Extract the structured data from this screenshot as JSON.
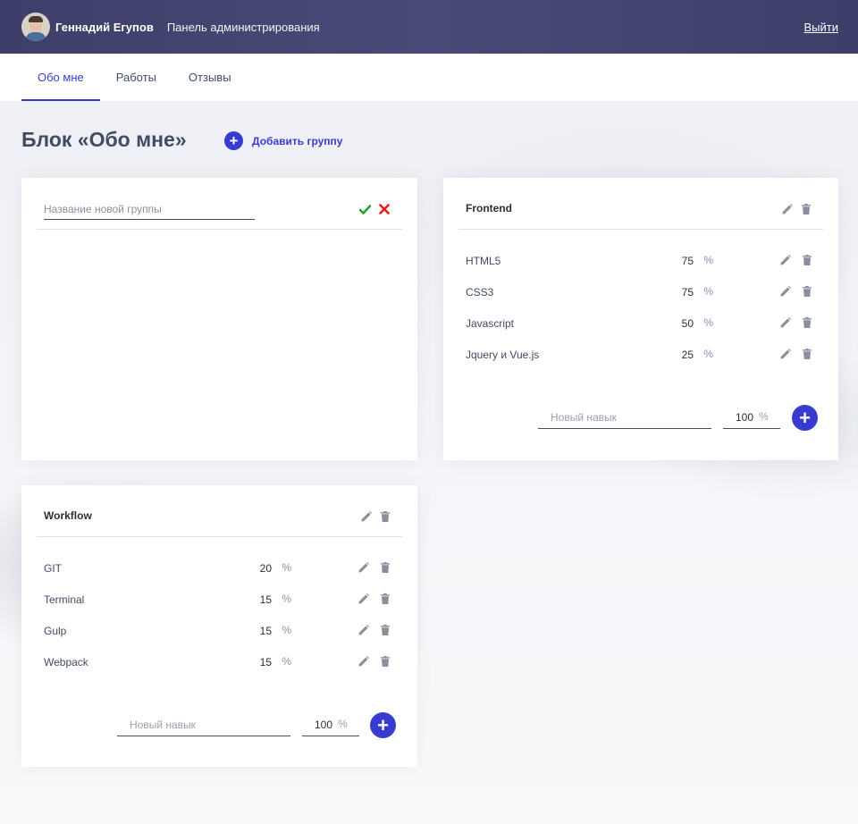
{
  "header": {
    "user_name": "Геннадий Егупов",
    "panel_title": "Панель администрирования",
    "logout_label": "Выйти"
  },
  "tabs": [
    {
      "label": "Обо мне",
      "active": true
    },
    {
      "label": "Работы",
      "active": false
    },
    {
      "label": "Отзывы",
      "active": false
    }
  ],
  "main": {
    "title": "Блок «Обо мне»",
    "add_group_label": "Добавить группу",
    "add_group_icon": "+"
  },
  "new_group_card": {
    "placeholder": "Название новой группы",
    "confirm_icon": "check-icon",
    "cancel_icon": "close-icon"
  },
  "groups": [
    {
      "name": "Frontend",
      "skills": [
        {
          "name": "HTML5",
          "percent": "75",
          "unit": "%"
        },
        {
          "name": "CSS3",
          "percent": "75",
          "unit": "%"
        },
        {
          "name": "Javascript",
          "percent": "50",
          "unit": "%"
        },
        {
          "name": "Jquery и Vue.js",
          "percent": "25",
          "unit": "%"
        }
      ],
      "new_skill_placeholder": "Новый навык",
      "new_percent_value": "100",
      "new_percent_unit": "%",
      "add_icon": "+"
    },
    {
      "name": "Workflow",
      "skills": [
        {
          "name": "GIT",
          "percent": "20",
          "unit": "%"
        },
        {
          "name": "Terminal",
          "percent": "15",
          "unit": "%"
        },
        {
          "name": "Gulp",
          "percent": "15",
          "unit": "%"
        },
        {
          "name": "Webpack",
          "percent": "15",
          "unit": "%"
        }
      ],
      "new_skill_placeholder": "Новый навык",
      "new_percent_value": "100",
      "new_percent_unit": "%",
      "add_icon": "+"
    }
  ],
  "colors": {
    "header_bg": "#3e3e6a",
    "accent": "#383bcf",
    "confirm": "#22a033",
    "cancel": "#e11d1d",
    "icon_gray": "#8a8f9e"
  }
}
